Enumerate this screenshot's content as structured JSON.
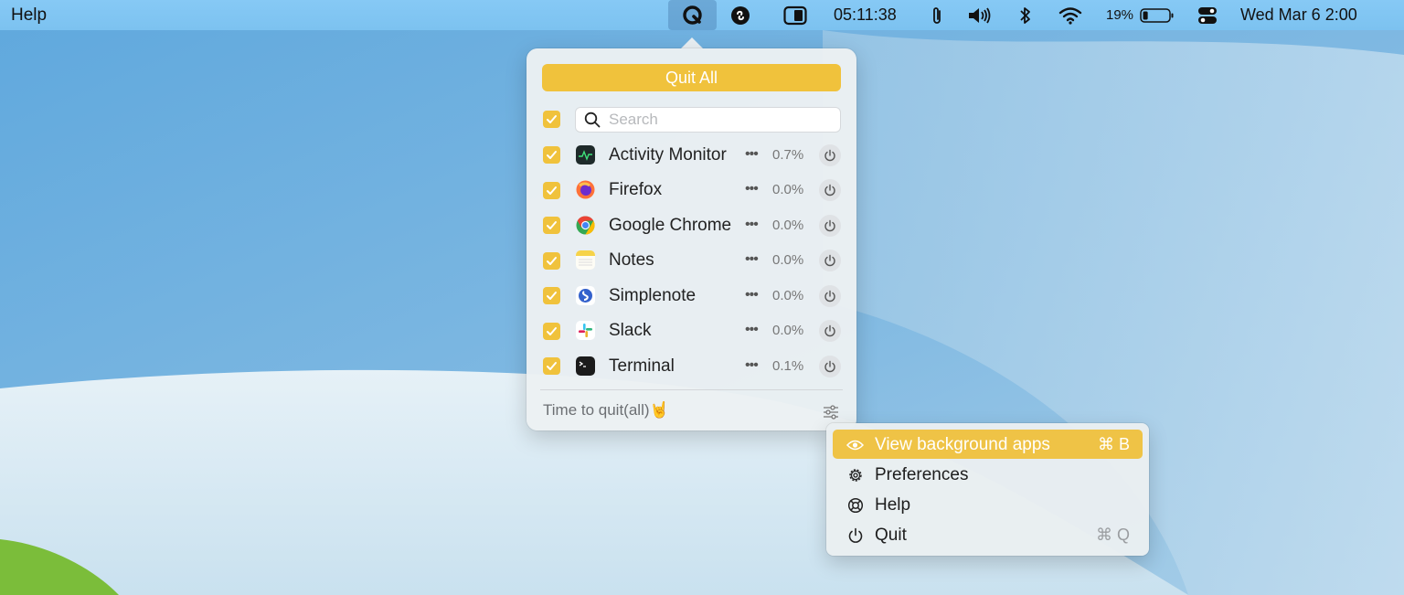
{
  "menubar": {
    "app_menu": "Help",
    "clock": "05:11:38",
    "battery_percent": "19%",
    "battery_level": 0.19,
    "datetime": "Wed Mar 6  2:00",
    "icons": [
      "quit-all-app-icon",
      "shazam-icon",
      "timer-icon",
      "paperclip-icon",
      "volume-icon",
      "bluetooth-icon",
      "wifi-icon",
      "battery-icon",
      "control-center-icon"
    ]
  },
  "popover": {
    "quit_all_label": "Quit All",
    "search_placeholder": "Search",
    "select_all_checked": true,
    "apps": [
      {
        "name": "Activity Monitor",
        "cpu": "0.7%",
        "checked": true,
        "icon": "activity-monitor-icon"
      },
      {
        "name": "Firefox",
        "cpu": "0.0%",
        "checked": true,
        "icon": "firefox-icon"
      },
      {
        "name": "Google Chrome",
        "cpu": "0.0%",
        "checked": true,
        "icon": "chrome-icon"
      },
      {
        "name": "Notes",
        "cpu": "0.0%",
        "checked": true,
        "icon": "notes-icon"
      },
      {
        "name": "Simplenote",
        "cpu": "0.0%",
        "checked": true,
        "icon": "simplenote-icon"
      },
      {
        "name": "Slack",
        "cpu": "0.0%",
        "checked": true,
        "icon": "slack-icon"
      },
      {
        "name": "Terminal",
        "cpu": "0.1%",
        "checked": true,
        "icon": "terminal-icon"
      }
    ],
    "more_glyph": "•••",
    "footer_text": "Time to quit(all)🤘"
  },
  "context_menu": {
    "items": [
      {
        "label": "View background apps",
        "shortcut": "⌘ B",
        "icon": "eye-icon",
        "highlighted": true
      },
      {
        "label": "Preferences",
        "shortcut": "",
        "icon": "gear-icon",
        "highlighted": false
      },
      {
        "label": "Help",
        "shortcut": "",
        "icon": "lifebuoy-icon",
        "highlighted": false
      },
      {
        "label": "Quit",
        "shortcut": "⌘ Q",
        "icon": "power-icon",
        "highlighted": false
      }
    ]
  },
  "colors": {
    "accent": "#f0c23c",
    "menubar": "#7fc4f2",
    "wallpaper_blue": "#5aa6dd",
    "wallpaper_light": "#d8ebf5"
  }
}
